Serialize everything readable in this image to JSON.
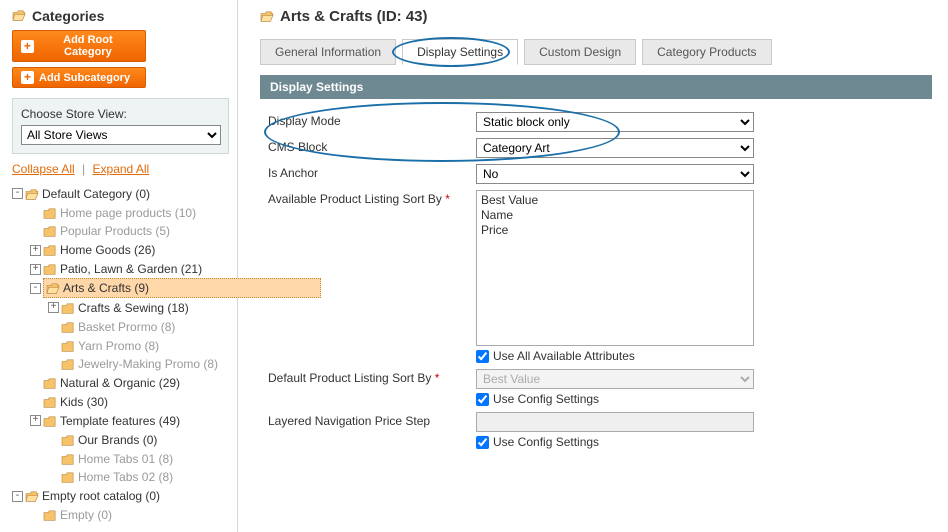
{
  "sidebar": {
    "title": "Categories",
    "buttons": {
      "add_root": "Add Root Category",
      "add_sub": "Add Subcategory"
    },
    "store_label": "Choose Store View:",
    "store_value": "All Store Views",
    "links": {
      "collapse": "Collapse All",
      "expand": "Expand All"
    },
    "tree": [
      {
        "toggle": "-",
        "label": "Default Category (0)",
        "open": true,
        "children": [
          {
            "toggle": "",
            "label": "Home page products (10)",
            "dim": true
          },
          {
            "toggle": "",
            "label": "Popular Products (5)",
            "dim": true
          },
          {
            "toggle": "+",
            "label": "Home Goods (26)"
          },
          {
            "toggle": "+",
            "label": "Patio, Lawn & Garden (21)"
          },
          {
            "toggle": "-",
            "label": "Arts & Crafts (9)",
            "selected": true,
            "open": true,
            "children": [
              {
                "toggle": "+",
                "label": "Crafts & Sewing (18)"
              },
              {
                "toggle": "",
                "label": "Basket Prormo (8)",
                "dim": true
              },
              {
                "toggle": "",
                "label": "Yarn Promo (8)",
                "dim": true
              },
              {
                "toggle": "",
                "label": "Jewelry-Making Promo (8)",
                "dim": true,
                "truncated": true
              }
            ]
          },
          {
            "toggle": "",
            "label": "Natural & Organic (29)"
          },
          {
            "toggle": "",
            "label": "Kids (30)"
          },
          {
            "toggle": "+",
            "label": "Template features (49)",
            "open": false
          },
          {
            "toggle": "",
            "label": "Our Brands (0)",
            "indent": 1
          },
          {
            "toggle": "",
            "label": "Home Tabs 01 (8)",
            "dim": true,
            "indent": 1
          },
          {
            "toggle": "",
            "label": "Home Tabs 02 (8)",
            "dim": true,
            "indent": 1
          }
        ]
      },
      {
        "toggle": "-",
        "label": "Empty root catalog (0)",
        "open": true,
        "children": [
          {
            "toggle": "",
            "label": "Empty (0)",
            "dim": true
          }
        ]
      }
    ]
  },
  "main": {
    "title": "Arts & Crafts (ID: 43)",
    "tabs": [
      {
        "label": "General Information"
      },
      {
        "label": "Display Settings",
        "active": true
      },
      {
        "label": "Custom Design"
      },
      {
        "label": "Category Products"
      }
    ],
    "section_title": "Display Settings",
    "fields": {
      "display_mode": {
        "label": "Display Mode",
        "value": "Static block only"
      },
      "cms_block": {
        "label": "CMS Block",
        "value": "Category Art"
      },
      "is_anchor": {
        "label": "Is Anchor",
        "value": "No"
      },
      "sort_by": {
        "label": "Available Product Listing Sort By",
        "required": true,
        "options": [
          "Best Value",
          "Name",
          "Price"
        ],
        "checkbox": "Use All Available Attributes",
        "checked": true
      },
      "default_sort": {
        "label": "Default Product Listing Sort By",
        "required": true,
        "value": "Best Value",
        "checkbox": "Use Config Settings",
        "checked": true
      },
      "price_step": {
        "label": "Layered Navigation Price Step",
        "value": "",
        "checkbox": "Use Config Settings",
        "checked": true
      }
    }
  }
}
